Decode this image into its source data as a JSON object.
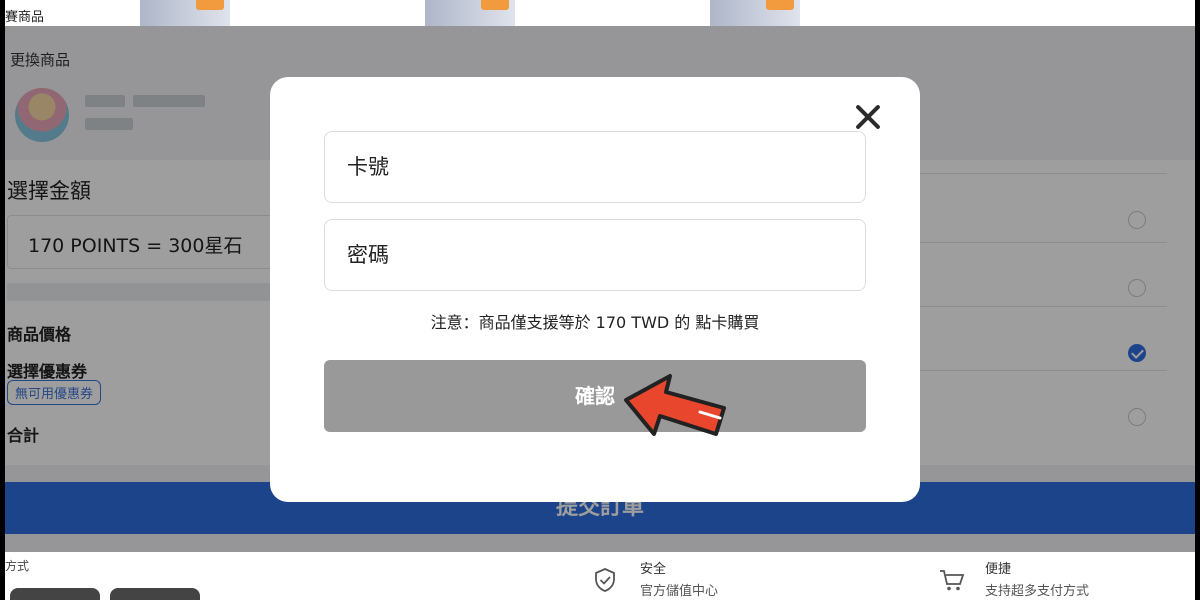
{
  "background_page": {
    "crumb": "賽商品",
    "change_product_label": "更換商品",
    "choose_amount_title": "選擇金額",
    "amount_option": "170 POINTS = 300星石",
    "price_label": "商品價格",
    "coupon_label": "選擇優惠券",
    "coupon_badge": "無可用優惠券",
    "total_label": "合計",
    "submit_label": "提交訂單",
    "footer": {
      "pay_method": "方式",
      "security_title": "安全",
      "security_sub": "官方儲值中心",
      "convenience_title": "便捷",
      "convenience_sub": "支持超多支付方式"
    },
    "icons": [
      "shield-check-icon",
      "cart-icon"
    ]
  },
  "modal": {
    "card_number_placeholder": "卡號",
    "password_placeholder": "密碼",
    "notice": "注意：商品僅支援等於 170 TWD 的 點卡購買",
    "confirm_label": "確認",
    "close_icon": "close-icon"
  },
  "colors": {
    "primary_blue": "#2e6fe0",
    "confirm_disabled": "#999999",
    "arrow_red": "#e8472e"
  }
}
